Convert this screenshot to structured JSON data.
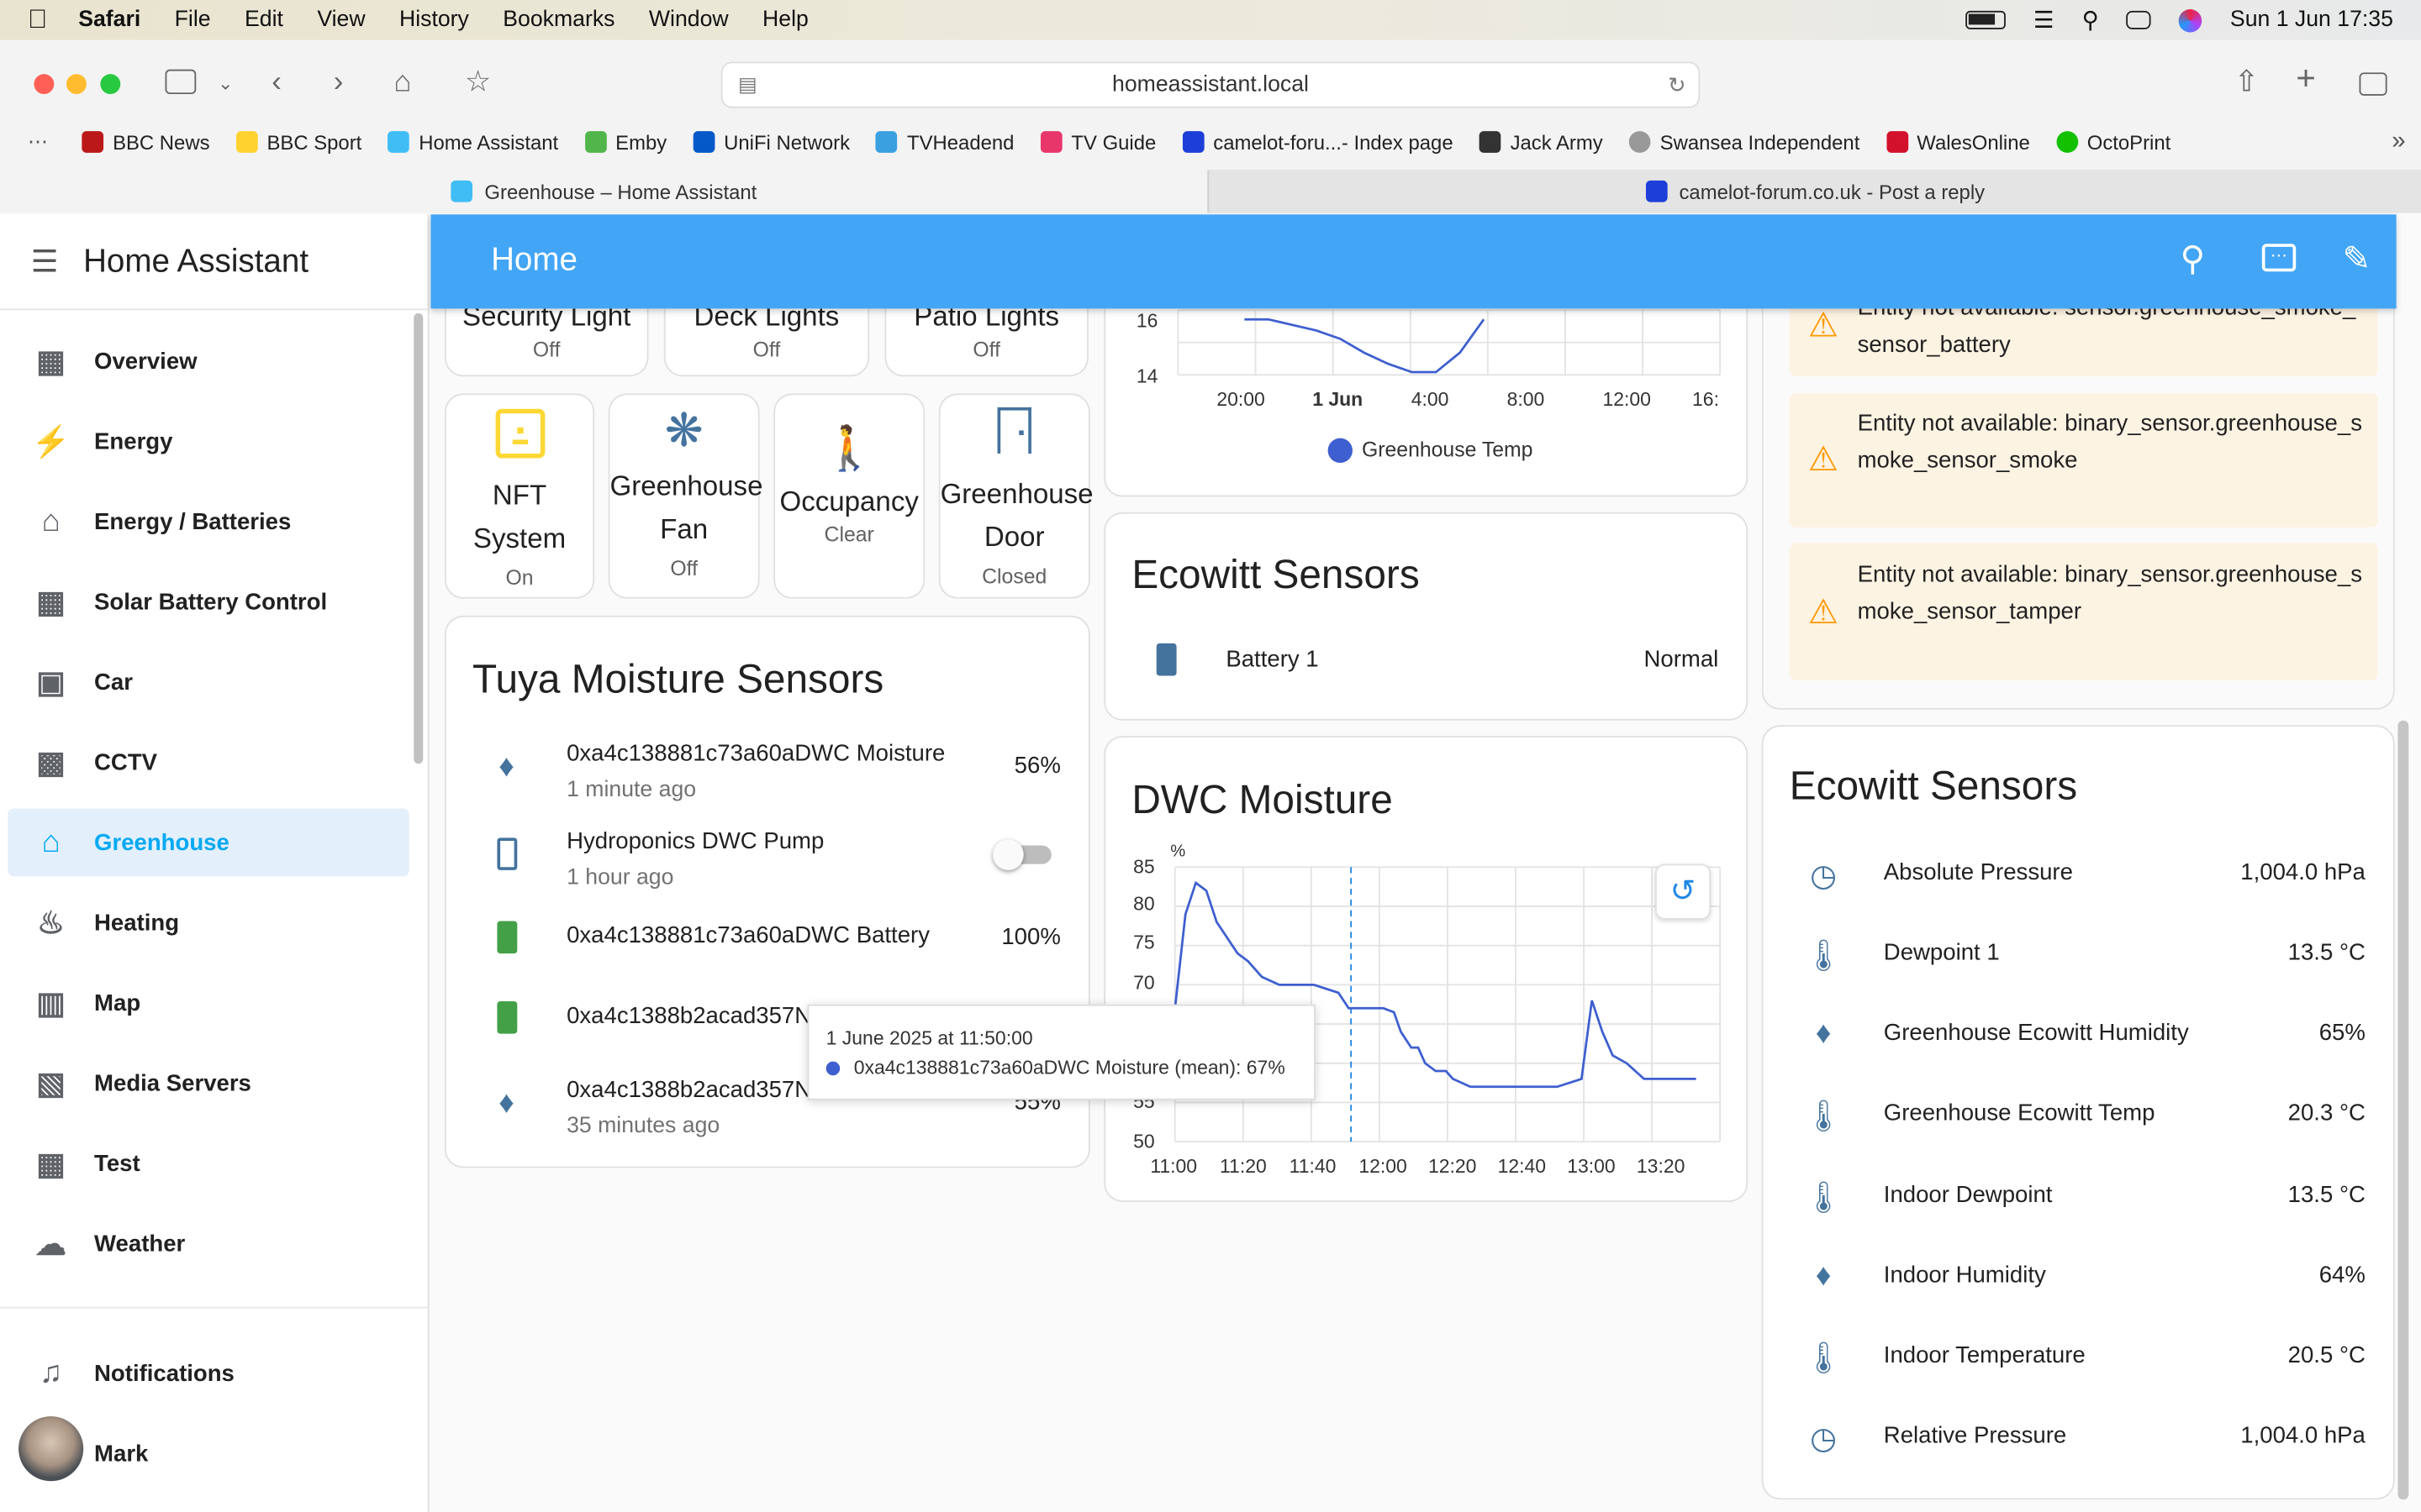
{
  "menubar": {
    "app": "Safari",
    "items": [
      "File",
      "Edit",
      "View",
      "History",
      "Bookmarks",
      "Window",
      "Help"
    ],
    "clock": "Sun 1 Jun  17:35"
  },
  "browser": {
    "url": "homeassistant.local",
    "bookmarks": [
      "BBC News",
      "BBC Sport",
      "Home Assistant",
      "Emby",
      "UniFi Network",
      "TVHeadend",
      "TV Guide",
      "camelot-foru...- Index page",
      "Jack Army",
      "Swansea Independent",
      "WalesOnline",
      "OctoPrint"
    ],
    "tabs": [
      "Greenhouse – Home Assistant",
      "camelot-forum.co.uk - Post a reply"
    ]
  },
  "sidebar": {
    "title": "Home Assistant",
    "items": [
      {
        "label": "Overview",
        "icon": "dashboard-icon"
      },
      {
        "label": "Energy",
        "icon": "lightning-icon"
      },
      {
        "label": "Energy / Batteries",
        "icon": "home-battery-icon"
      },
      {
        "label": "Solar Battery Control",
        "icon": "solar-panel-icon"
      },
      {
        "label": "Car",
        "icon": "car-icon"
      },
      {
        "label": "CCTV",
        "icon": "cctv-icon"
      },
      {
        "label": "Greenhouse",
        "icon": "greenhouse-icon"
      },
      {
        "label": "Heating",
        "icon": "fire-icon"
      },
      {
        "label": "Map",
        "icon": "map-icon"
      },
      {
        "label": "Media Servers",
        "icon": "film-icon"
      },
      {
        "label": "Test",
        "icon": "dashboard-icon"
      },
      {
        "label": "Weather",
        "icon": "cloud-icon"
      }
    ],
    "notifications": "Notifications",
    "user": "Mark"
  },
  "appbar": {
    "title": "Home"
  },
  "col1": {
    "top_tiles": [
      {
        "name": "Security Light",
        "state": "Off"
      },
      {
        "name": "Deck Lights",
        "state": "Off"
      },
      {
        "name": "Patio Lights",
        "state": "Off"
      }
    ],
    "tiles": [
      {
        "line1": "NFT",
        "line2": "System",
        "state": "On"
      },
      {
        "line1": "Greenhouse",
        "line2": "Fan",
        "state": "Off"
      },
      {
        "line1": "Occupancy",
        "line2": "",
        "state": "Clear"
      },
      {
        "line1": "Greenhouse",
        "line2": "Door",
        "state": "Closed"
      }
    ],
    "tuya": {
      "title": "Tuya Moisture Sensors",
      "rows": [
        {
          "name": "0xa4c138881c73a60aDWC Moisture",
          "sub": "1 minute ago",
          "value": "56%"
        },
        {
          "name": "Hydroponics DWC Pump",
          "sub": "1 hour ago",
          "value": ""
        },
        {
          "name": "0xa4c138881c73a60aDWC Battery",
          "sub": "",
          "value": "100%"
        },
        {
          "name": "0xa4c1388b2acad357N",
          "sub": "",
          "value": ""
        },
        {
          "name": "0xa4c1388b2acad357N",
          "sub": "35 minutes ago",
          "value": "55%"
        }
      ]
    }
  },
  "col2": {
    "temp_chart": {
      "ticks_y": [
        "16",
        "14"
      ],
      "ticks_x": [
        "20:00",
        "1 Jun",
        "4:00",
        "8:00",
        "12:00",
        "16:"
      ],
      "legend": "Greenhouse Temp"
    },
    "ecowitt_small": {
      "title": "Ecowitt Sensors",
      "row": {
        "name": "Battery 1",
        "value": "Normal"
      }
    },
    "dwc": {
      "title": "DWC Moisture",
      "unit": "%",
      "ticks_y": [
        "85",
        "80",
        "75",
        "70",
        "55",
        "50"
      ],
      "ticks_x": [
        "11:00",
        "11:20",
        "11:40",
        "12:00",
        "12:20",
        "12:40",
        "13:00",
        "13:20"
      ]
    },
    "tooltip": {
      "title": "1 June 2025 at 11:50:00",
      "line": "0xa4c138881c73a60aDWC Moisture (mean): 67%"
    }
  },
  "col3": {
    "warnings": [
      "Entity not available: sensor.greenhouse_smoke_sensor_battery",
      "Entity not available: binary_sensor.greenhouse_smoke_sensor_smoke",
      "Entity not available: binary_sensor.greenhouse_smoke_sensor_tamper"
    ],
    "ecowitt": {
      "title": "Ecowitt Sensors",
      "rows": [
        {
          "name": "Absolute Pressure",
          "value": "1,004.0 hPa",
          "icon": "gauge-icon"
        },
        {
          "name": "Dewpoint 1",
          "value": "13.5 °C",
          "icon": "thermometer-icon"
        },
        {
          "name": "Greenhouse Ecowitt Humidity",
          "value": "65%",
          "icon": "water-percent-icon"
        },
        {
          "name": "Greenhouse Ecowitt Temp",
          "value": "20.3 °C",
          "icon": "thermometer-icon"
        },
        {
          "name": "Indoor Dewpoint",
          "value": "13.5 °C",
          "icon": "thermometer-icon"
        },
        {
          "name": "Indoor Humidity",
          "value": "64%",
          "icon": "water-percent-icon"
        },
        {
          "name": "Indoor Temperature",
          "value": "20.5 °C",
          "icon": "thermometer-icon"
        },
        {
          "name": "Relative Pressure",
          "value": "1,004.0 hPa",
          "icon": "gauge-icon"
        }
      ]
    }
  },
  "chart_data": [
    {
      "type": "line",
      "series": [
        {
          "name": "Greenhouse Temp",
          "x": [
            "22:00",
            "23:00",
            "0:00",
            "1:00",
            "2:00",
            "3:00",
            "4:00",
            "5:00",
            "6:00",
            "7:00",
            "8:00"
          ],
          "values": [
            16.0,
            16.0,
            15.8,
            15.6,
            15.3,
            14.8,
            14.4,
            14.1,
            14.1,
            14.8,
            16.0
          ]
        }
      ],
      "ylim": [
        14,
        17
      ]
    },
    {
      "type": "line",
      "series": [
        {
          "name": "0xa4c138881c73a60aDWC Moisture",
          "x": [
            "11:00",
            "11:03",
            "11:06",
            "11:09",
            "11:12",
            "11:15",
            "11:18",
            "11:21",
            "11:25",
            "11:30",
            "11:40",
            "11:47",
            "11:50",
            "11:55",
            "12:00",
            "12:03",
            "12:05",
            "12:08",
            "12:10",
            "12:12",
            "12:15",
            "12:18",
            "12:20",
            "12:25",
            "12:30",
            "12:40",
            "12:50",
            "12:57",
            "13:00",
            "13:03",
            "13:06",
            "13:10",
            "13:15",
            "13:20",
            "13:30"
          ],
          "values": [
            67,
            79,
            83,
            82,
            78,
            76,
            74,
            73,
            71,
            70,
            70,
            69,
            67,
            67,
            67,
            66.5,
            64,
            62,
            62,
            60,
            59,
            59,
            58,
            57,
            57,
            57,
            57,
            58,
            68,
            64,
            61,
            60,
            58,
            58,
            58
          ]
        }
      ],
      "ylim": [
        50,
        85
      ]
    }
  ]
}
